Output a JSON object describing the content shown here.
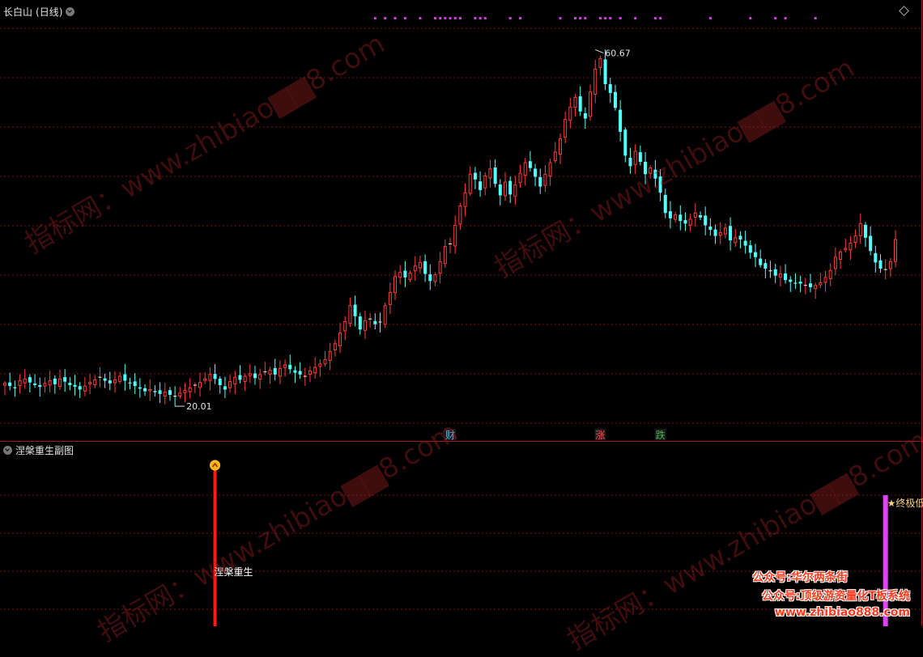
{
  "main_title": "长白山",
  "period": "(日线)",
  "sub_title": "涅槃重生副图",
  "chart_data": {
    "type": "candlestick",
    "price_range": [
      18,
      62
    ],
    "high_label": "60.67",
    "low_label": "20.01",
    "high_index": 118,
    "low_index": 34,
    "markers": [
      {
        "text": "财",
        "index": 89,
        "color": "#4fc3f7"
      },
      {
        "text": "涨",
        "index": 119,
        "color": "#ff5050"
      },
      {
        "text": "跌",
        "index": 131,
        "color": "#4caf50"
      }
    ],
    "dot_indices": [
      74,
      76,
      78,
      80,
      83,
      86,
      87,
      88,
      89,
      90,
      91,
      94,
      95,
      96,
      101,
      103,
      111,
      114,
      115,
      116,
      119,
      120,
      121,
      123,
      126,
      130,
      131,
      141,
      149,
      154,
      156,
      162
    ],
    "closes": [
      21.5,
      21.2,
      21.0,
      21.8,
      22.0,
      21.6,
      21.3,
      21.1,
      21.5,
      21.8,
      21.4,
      22.0,
      21.7,
      21.3,
      21.1,
      20.8,
      21.2,
      21.6,
      21.9,
      22.2,
      21.8,
      21.5,
      21.9,
      22.3,
      21.8,
      21.5,
      21.2,
      20.9,
      20.6,
      20.8,
      20.5,
      20.3,
      20.5,
      20.2,
      20.01,
      20.4,
      20.7,
      21.0,
      21.3,
      21.6,
      22.0,
      22.5,
      22.0,
      21.3,
      20.8,
      21.7,
      22.2,
      21.9,
      22.3,
      22.6,
      22.1,
      22.5,
      22.8,
      23.0,
      22.5,
      23.2,
      23.6,
      23.1,
      22.7,
      22.5,
      22.3,
      22.9,
      23.3,
      23.7,
      24.2,
      25.1,
      26.0,
      27.2,
      28.5,
      30.3,
      29.1,
      27.6,
      28.6,
      28.8,
      28.2,
      28.4,
      30.3,
      31.8,
      33.6,
      34.1,
      33.5,
      34.0,
      34.8,
      35.2,
      33.9,
      33.1,
      33.8,
      35.3,
      37.0,
      37.3,
      39.4,
      41.6,
      43.1,
      45.2,
      44.6,
      43.4,
      45.0,
      45.8,
      44.1,
      42.8,
      44.3,
      42.9,
      44.0,
      45.3,
      46.5,
      45.9,
      44.9,
      43.8,
      45.2,
      46.5,
      47.7,
      49.2,
      51.4,
      52.8,
      53.9,
      52.3,
      51.5,
      54.5,
      57.1,
      58.3,
      55.4,
      54.4,
      52.7,
      50.0,
      47.3,
      46.1,
      47.8,
      46.6,
      45.2,
      45.9,
      44.7,
      43.1,
      40.8,
      40.2,
      40.6,
      39.9,
      39.6,
      40.1,
      40.8,
      40.3,
      39.4,
      38.9,
      38.2,
      38.6,
      39.1,
      37.7,
      38.0,
      37.8,
      37.1,
      36.3,
      35.8,
      34.9,
      34.5,
      34.2,
      33.7,
      33.9,
      33.2,
      33.0,
      32.8,
      32.8,
      32.6,
      32.4,
      32.6,
      32.9,
      33.5,
      34.3,
      35.8,
      36.4,
      36.8,
      37.4,
      38.2,
      39.6,
      38.0,
      36.5,
      35.2,
      34.5,
      34.4,
      35.3,
      37.8
    ]
  },
  "signals": [
    {
      "label": "涅槃重生",
      "index": 42,
      "color": "#ff1a1a"
    },
    {
      "label": "终极低点",
      "index": 176,
      "color": "#e040fb"
    }
  ],
  "watermark_text": "指标网：www.zhibiao▆▆8.com",
  "promo_lines": [
    "公众号:华尔两条街",
    "公众号:顶级游资量化T板系统",
    "www.zhibiao888.com"
  ]
}
